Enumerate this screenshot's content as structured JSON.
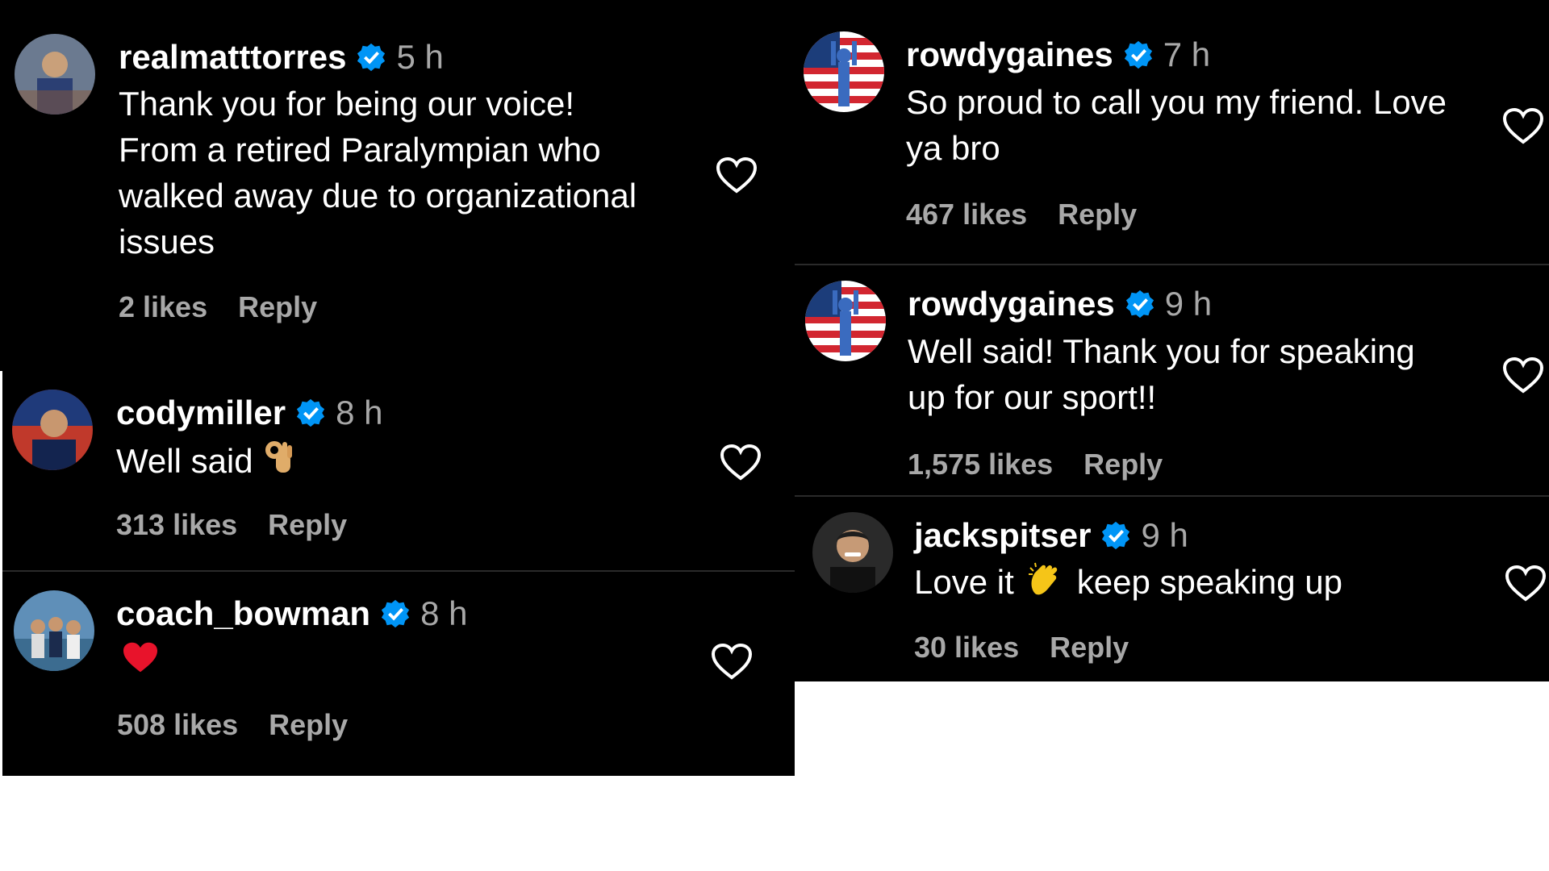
{
  "colors": {
    "background": "#000000",
    "page": "#ffffff",
    "username": "#ffffff",
    "meta": "#a8a8a8",
    "verified": "#0095f6"
  },
  "left": [
    {
      "username": "realmatttorres",
      "time": "5 h",
      "text_lines": [
        "Thank you for being our voice!",
        "From a retired Paralympian who",
        "walked away due to organizational",
        "issues"
      ],
      "likes": "2 likes",
      "reply": "Reply"
    },
    {
      "username": "codymiller",
      "time": "8 h",
      "text_lines": [
        "Well said"
      ],
      "emoji": "ok-hand-emoji",
      "likes": "313 likes",
      "reply": "Reply"
    },
    {
      "username": "coach_bowman",
      "time": "8 h",
      "text_lines": [],
      "emoji": "red-heart-emoji",
      "likes": "508 likes",
      "reply": "Reply"
    }
  ],
  "right": [
    {
      "username": "rowdygaines",
      "time": "7 h",
      "text_lines": [
        "So proud to call you my friend. Love",
        "ya bro"
      ],
      "likes": "467 likes",
      "reply": "Reply"
    },
    {
      "username": "rowdygaines",
      "time": "9 h",
      "text_lines": [
        "Well said! Thank you for speaking",
        "up for our sport!!"
      ],
      "likes": "1,575 likes",
      "reply": "Reply"
    },
    {
      "username": "jackspitser",
      "time": "9 h",
      "text_before": "Love it",
      "emoji": "clapping-hands-emoji",
      "text_after": "keep speaking up",
      "likes": "30 likes",
      "reply": "Reply"
    }
  ]
}
